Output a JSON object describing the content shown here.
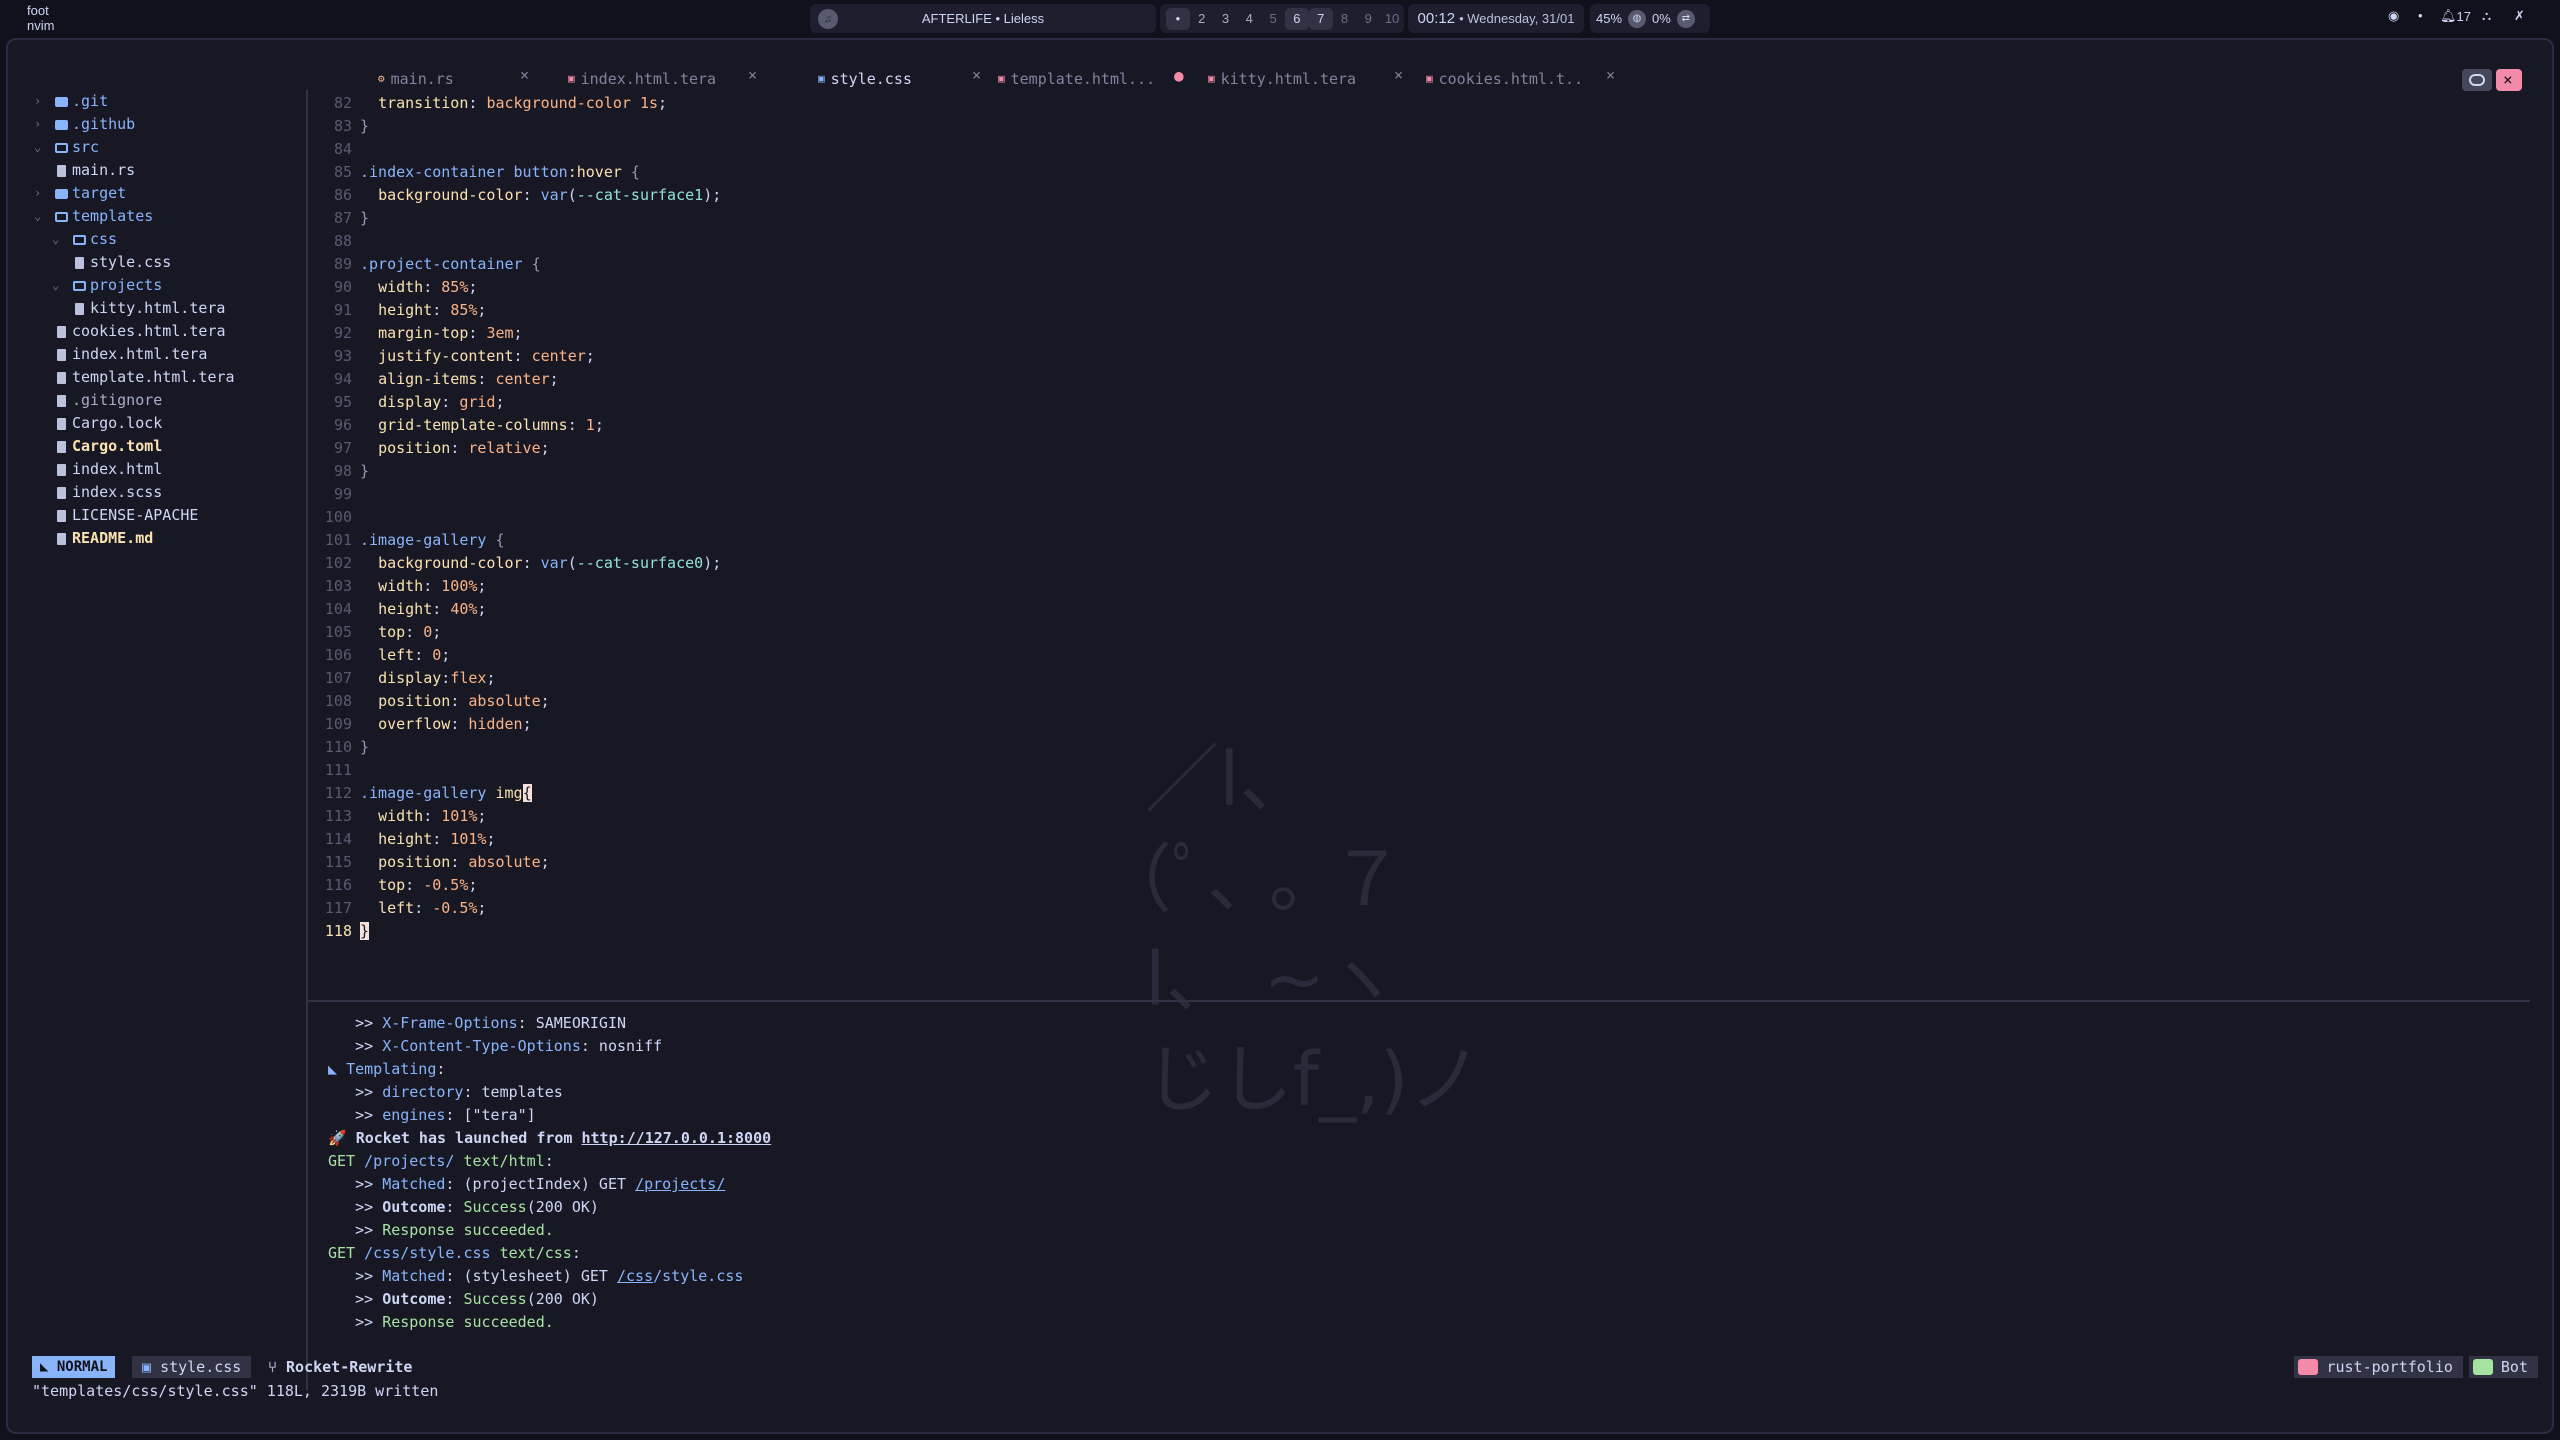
{
  "topbar": {
    "app_class": "foot",
    "app_title": "nvim",
    "media_text": "AFTERLIFE • Lieless",
    "media_icon": "music-icon",
    "workspaces": [
      {
        "label": "•",
        "state": "active"
      },
      {
        "label": "2",
        "state": "normal"
      },
      {
        "label": "3",
        "state": "normal"
      },
      {
        "label": "4",
        "state": "normal"
      },
      {
        "label": "5",
        "state": "empty"
      },
      {
        "label": "6",
        "state": "occupied"
      },
      {
        "label": "7",
        "state": "occupied"
      },
      {
        "label": "8",
        "state": "empty"
      },
      {
        "label": "9",
        "state": "empty"
      },
      {
        "label": "10",
        "state": "empty"
      }
    ],
    "time": "00:12",
    "date": "• Wednesday, 31/01",
    "cpu": "45%",
    "ram": "0%",
    "notifications": "17",
    "dot": "•"
  },
  "tree": [
    {
      "label": ".git",
      "kind": "dir",
      "open": false,
      "depth": 0
    },
    {
      "label": ".github",
      "kind": "dir",
      "open": false,
      "depth": 0
    },
    {
      "label": "src",
      "kind": "dir",
      "open": true,
      "depth": 0
    },
    {
      "label": "main.rs",
      "kind": "file",
      "depth": 1
    },
    {
      "label": "target",
      "kind": "dir",
      "open": false,
      "depth": 0
    },
    {
      "label": "templates",
      "kind": "dir",
      "open": true,
      "depth": 0
    },
    {
      "label": "css",
      "kind": "dir",
      "open": true,
      "depth": 1
    },
    {
      "label": "style.css",
      "kind": "file",
      "depth": 2
    },
    {
      "label": "projects",
      "kind": "dir",
      "open": true,
      "depth": 1
    },
    {
      "label": "kitty.html.tera",
      "kind": "file",
      "depth": 2
    },
    {
      "label": "cookies.html.tera",
      "kind": "file",
      "depth": 1
    },
    {
      "label": "index.html.tera",
      "kind": "file",
      "depth": 1
    },
    {
      "label": "template.html.tera",
      "kind": "file",
      "depth": 1
    },
    {
      "label": ".gitignore",
      "kind": "file",
      "depth": 0,
      "style": "dim"
    },
    {
      "label": "Cargo.lock",
      "kind": "file",
      "depth": 0
    },
    {
      "label": "Cargo.toml",
      "kind": "file",
      "depth": 0,
      "style": "bold"
    },
    {
      "label": "index.html",
      "kind": "file",
      "depth": 0
    },
    {
      "label": "index.scss",
      "kind": "file",
      "depth": 0
    },
    {
      "label": "LICENSE-APACHE",
      "kind": "file",
      "depth": 0
    },
    {
      "label": "README.md",
      "kind": "file",
      "depth": 0,
      "style": "bold"
    }
  ],
  "tabs": [
    {
      "label": "main.rs",
      "active": false,
      "modified": false,
      "icon": "rust-icon",
      "color": "#fab387"
    },
    {
      "label": "index.html.tera",
      "active": false,
      "modified": false,
      "icon": "file-icon",
      "color": "#f38ba8"
    },
    {
      "label": "style.css",
      "active": true,
      "modified": false,
      "icon": "css-icon",
      "color": "#89b4fa"
    },
    {
      "label": "template.html...",
      "active": false,
      "modified": true,
      "icon": "file-icon",
      "color": "#f38ba8"
    },
    {
      "label": "kitty.html.tera",
      "active": false,
      "modified": false,
      "icon": "file-icon",
      "color": "#f38ba8"
    },
    {
      "label": "cookies.html.t..",
      "active": false,
      "modified": false,
      "icon": "file-icon",
      "color": "#f38ba8"
    }
  ],
  "tab_close_glyph": "×",
  "tab_modified_glyph": "●",
  "code": [
    {
      "n": "82",
      "t": [
        [
          "  ",
          ""
        ],
        [
          "transition",
          "prop"
        ],
        [
          ": ",
          "punct"
        ],
        [
          "background-color 1s",
          "val"
        ],
        [
          ";",
          "punct"
        ]
      ]
    },
    {
      "n": "83",
      "t": [
        [
          "}",
          "brace"
        ]
      ]
    },
    {
      "n": "84",
      "t": []
    },
    {
      "n": "85",
      "t": [
        [
          ".index-container button",
          "sel"
        ],
        [
          ":hover",
          "prop"
        ],
        [
          " {",
          "brace"
        ]
      ]
    },
    {
      "n": "86",
      "t": [
        [
          "  ",
          ""
        ],
        [
          "background-color",
          "prop"
        ],
        [
          ": ",
          "punct"
        ],
        [
          "var",
          "func"
        ],
        [
          "(",
          "punct"
        ],
        [
          "--cat-surface1",
          "var"
        ],
        [
          ");",
          "punct"
        ]
      ]
    },
    {
      "n": "87",
      "t": [
        [
          "}",
          "brace"
        ]
      ]
    },
    {
      "n": "88",
      "t": []
    },
    {
      "n": "89",
      "t": [
        [
          ".project-container",
          "sel"
        ],
        [
          " {",
          "brace"
        ]
      ]
    },
    {
      "n": "90",
      "t": [
        [
          "  ",
          ""
        ],
        [
          "width",
          "prop"
        ],
        [
          ": ",
          "punct"
        ],
        [
          "85%",
          "val"
        ],
        [
          ";",
          "punct"
        ]
      ]
    },
    {
      "n": "91",
      "t": [
        [
          "  ",
          ""
        ],
        [
          "height",
          "prop"
        ],
        [
          ": ",
          "punct"
        ],
        [
          "85%",
          "val"
        ],
        [
          ";",
          "punct"
        ]
      ]
    },
    {
      "n": "92",
      "t": [
        [
          "  ",
          ""
        ],
        [
          "margin-top",
          "prop"
        ],
        [
          ": ",
          "punct"
        ],
        [
          "3em",
          "val"
        ],
        [
          ";",
          "punct"
        ]
      ]
    },
    {
      "n": "93",
      "t": [
        [
          "  ",
          ""
        ],
        [
          "justify-content",
          "prop"
        ],
        [
          ": ",
          "punct"
        ],
        [
          "center",
          "val"
        ],
        [
          ";",
          "punct"
        ]
      ]
    },
    {
      "n": "94",
      "t": [
        [
          "  ",
          ""
        ],
        [
          "align-items",
          "prop"
        ],
        [
          ": ",
          "punct"
        ],
        [
          "center",
          "val"
        ],
        [
          ";",
          "punct"
        ]
      ]
    },
    {
      "n": "95",
      "t": [
        [
          "  ",
          ""
        ],
        [
          "display",
          "prop"
        ],
        [
          ": ",
          "punct"
        ],
        [
          "grid",
          "val"
        ],
        [
          ";",
          "punct"
        ]
      ]
    },
    {
      "n": "96",
      "t": [
        [
          "  ",
          ""
        ],
        [
          "grid-template-columns",
          "prop"
        ],
        [
          ": ",
          "punct"
        ],
        [
          "1",
          "val"
        ],
        [
          ";",
          "punct"
        ]
      ]
    },
    {
      "n": "97",
      "t": [
        [
          "  ",
          ""
        ],
        [
          "position",
          "prop"
        ],
        [
          ": ",
          "punct"
        ],
        [
          "relative",
          "val"
        ],
        [
          ";",
          "punct"
        ]
      ]
    },
    {
      "n": "98",
      "t": [
        [
          "}",
          "brace"
        ]
      ]
    },
    {
      "n": "99",
      "t": []
    },
    {
      "n": "100",
      "t": []
    },
    {
      "n": "101",
      "t": [
        [
          ".image-gallery",
          "sel"
        ],
        [
          " {",
          "brace"
        ]
      ]
    },
    {
      "n": "102",
      "t": [
        [
          "  ",
          ""
        ],
        [
          "background-color",
          "prop"
        ],
        [
          ": ",
          "punct"
        ],
        [
          "var",
          "func"
        ],
        [
          "(",
          "punct"
        ],
        [
          "--cat-surface0",
          "var"
        ],
        [
          ");",
          "punct"
        ]
      ]
    },
    {
      "n": "103",
      "t": [
        [
          "  ",
          ""
        ],
        [
          "width",
          "prop"
        ],
        [
          ": ",
          "punct"
        ],
        [
          "100%",
          "val"
        ],
        [
          ";",
          "punct"
        ]
      ]
    },
    {
      "n": "104",
      "t": [
        [
          "  ",
          ""
        ],
        [
          "height",
          "prop"
        ],
        [
          ": ",
          "punct"
        ],
        [
          "40%",
          "val"
        ],
        [
          ";",
          "punct"
        ]
      ]
    },
    {
      "n": "105",
      "t": [
        [
          "  ",
          ""
        ],
        [
          "top",
          "prop"
        ],
        [
          ": ",
          "punct"
        ],
        [
          "0",
          "val"
        ],
        [
          ";",
          "punct"
        ]
      ]
    },
    {
      "n": "106",
      "t": [
        [
          "  ",
          ""
        ],
        [
          "left",
          "prop"
        ],
        [
          ": ",
          "punct"
        ],
        [
          "0",
          "val"
        ],
        [
          ";",
          "punct"
        ]
      ]
    },
    {
      "n": "107",
      "t": [
        [
          "  ",
          ""
        ],
        [
          "display",
          "prop"
        ],
        [
          ":",
          "punct"
        ],
        [
          "flex",
          "val"
        ],
        [
          ";",
          "punct"
        ]
      ]
    },
    {
      "n": "108",
      "t": [
        [
          "  ",
          ""
        ],
        [
          "position",
          "prop"
        ],
        [
          ": ",
          "punct"
        ],
        [
          "absolute",
          "val"
        ],
        [
          ";",
          "punct"
        ]
      ]
    },
    {
      "n": "109",
      "t": [
        [
          "  ",
          ""
        ],
        [
          "overflow",
          "prop"
        ],
        [
          ": ",
          "punct"
        ],
        [
          "hidden",
          "val"
        ],
        [
          ";",
          "punct"
        ]
      ]
    },
    {
      "n": "110",
      "t": [
        [
          "}",
          "brace"
        ]
      ]
    },
    {
      "n": "111",
      "t": []
    },
    {
      "n": "112",
      "t": [
        [
          ".image-gallery ",
          "sel"
        ],
        [
          "img",
          "prop"
        ],
        [
          "{",
          "cursor"
        ]
      ]
    },
    {
      "n": "113",
      "t": [
        [
          "  ",
          ""
        ],
        [
          "width",
          "prop"
        ],
        [
          ": ",
          "punct"
        ],
        [
          "101%",
          "val"
        ],
        [
          ";",
          "punct"
        ]
      ]
    },
    {
      "n": "114",
      "t": [
        [
          "  ",
          ""
        ],
        [
          "height",
          "prop"
        ],
        [
          ": ",
          "punct"
        ],
        [
          "101%",
          "val"
        ],
        [
          ";",
          "punct"
        ]
      ]
    },
    {
      "n": "115",
      "t": [
        [
          "  ",
          ""
        ],
        [
          "position",
          "prop"
        ],
        [
          ": ",
          "punct"
        ],
        [
          "absolute",
          "val"
        ],
        [
          ";",
          "punct"
        ]
      ]
    },
    {
      "n": "116",
      "t": [
        [
          "  ",
          ""
        ],
        [
          "top",
          "prop"
        ],
        [
          ": ",
          "punct"
        ],
        [
          "-0.5%",
          "val"
        ],
        [
          ";",
          "punct"
        ]
      ]
    },
    {
      "n": "117",
      "t": [
        [
          "  ",
          ""
        ],
        [
          "left",
          "prop"
        ],
        [
          ": ",
          "punct"
        ],
        [
          "-0.5%",
          "val"
        ],
        [
          ";",
          "punct"
        ]
      ]
    },
    {
      "n": "118",
      "t": [
        [
          "}",
          "cursor"
        ]
      ],
      "current": true
    }
  ],
  "kaomoji": [
    "  ／l、",
    "（ﾟ､ ｡ ７",
    "  l、 ~ヽ",
    "  じしf_,)ノ"
  ],
  "terminal": [
    [
      [
        "   >> ",
        ""
      ],
      [
        "X-Frame-Options",
        "t-key"
      ],
      [
        ": SAMEORIGIN",
        ""
      ]
    ],
    [
      [
        "   >> ",
        ""
      ],
      [
        "X-Content-Type-Options",
        "t-key"
      ],
      [
        ": nosniff",
        ""
      ]
    ],
    [
      [
        "◣ ",
        "t-key"
      ],
      [
        "Templating",
        "t-key"
      ],
      [
        ":",
        ""
      ]
    ],
    [
      [
        "   >> ",
        ""
      ],
      [
        "directory",
        "t-key"
      ],
      [
        ": templates",
        ""
      ]
    ],
    [
      [
        "   >> ",
        ""
      ],
      [
        "engines",
        "t-key"
      ],
      [
        ": [\"tera\"]",
        ""
      ]
    ],
    [
      [
        "🚀 ",
        "t-key"
      ],
      [
        "Rocket has launched from ",
        "t-bold"
      ],
      [
        "http://127.0.0.1:8000",
        "t-link white"
      ]
    ],
    [
      [
        "GET ",
        "t-green"
      ],
      [
        "/projects/",
        "t-key"
      ],
      [
        " text/html",
        "t-green"
      ],
      [
        ":",
        ""
      ]
    ],
    [
      [
        "   >> ",
        ""
      ],
      [
        "Matched",
        "t-key"
      ],
      [
        ": (projectIndex) GET ",
        ""
      ],
      [
        "/projects/",
        "t-link"
      ]
    ],
    [
      [
        "   >> ",
        ""
      ],
      [
        "Outcome",
        "t-bold"
      ],
      [
        ": ",
        ""
      ],
      [
        "Success",
        "t-green"
      ],
      [
        "(200 OK)",
        ""
      ]
    ],
    [
      [
        "   >> ",
        ""
      ],
      [
        "Response succeeded.",
        "t-green"
      ]
    ],
    [
      [
        "GET ",
        "t-green"
      ],
      [
        "/css/style.css",
        "t-key"
      ],
      [
        " text/css",
        "t-green"
      ],
      [
        ":",
        ""
      ]
    ],
    [
      [
        "   >> ",
        ""
      ],
      [
        "Matched",
        "t-key"
      ],
      [
        ": (stylesheet) GET ",
        ""
      ],
      [
        "/css",
        "t-link"
      ],
      [
        "/style.css",
        "t-key"
      ]
    ],
    [
      [
        "   >> ",
        ""
      ],
      [
        "Outcome",
        "t-bold"
      ],
      [
        ": ",
        ""
      ],
      [
        "Success",
        "t-green"
      ],
      [
        "(200 OK)",
        ""
      ]
    ],
    [
      [
        "   >> ",
        ""
      ],
      [
        "Response succeeded.",
        "t-green"
      ]
    ]
  ],
  "statusline": {
    "mode": "NORMAL",
    "file": "style.css",
    "branch": "Rocket-Rewrite",
    "project": "rust-portfolio",
    "position": "Bot"
  },
  "cmdline": "\"templates/css/style.css\" 118L, 2319B written",
  "colors": {
    "bg": "#181825",
    "accent": "#89b4fa",
    "red": "#f38ba8",
    "green": "#a6e3a1",
    "yellow": "#f9e2af",
    "peach": "#fab387"
  }
}
